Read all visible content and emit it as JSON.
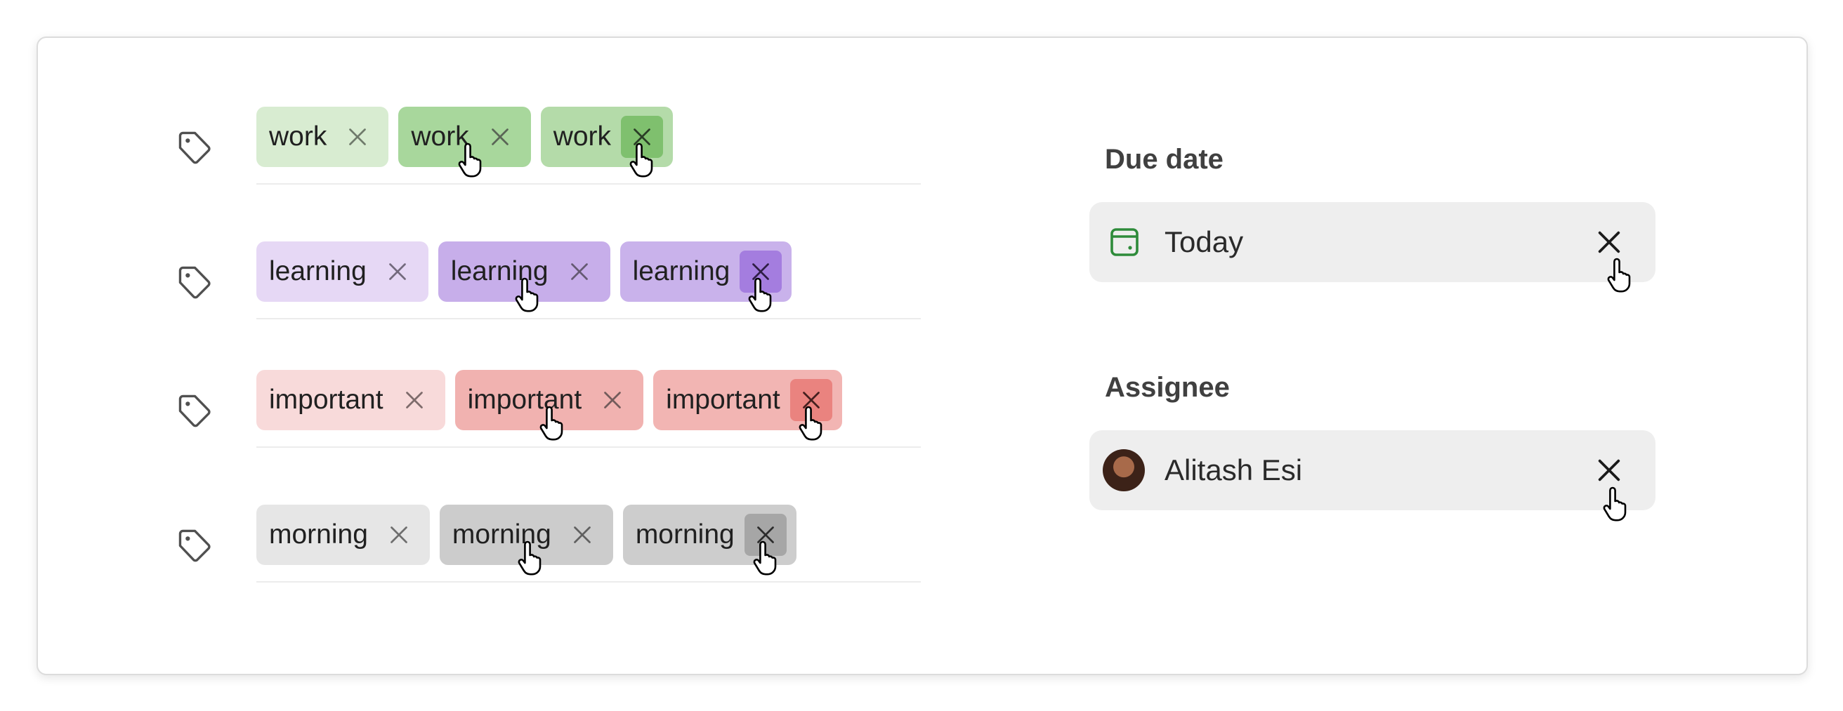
{
  "tags": [
    {
      "icon": "tag-icon",
      "chips": [
        {
          "label": "work",
          "state": "default",
          "bg": "#d8ecd1",
          "xbg": "transparent",
          "xcolor": "#6f7a6b"
        },
        {
          "label": "work",
          "state": "hover",
          "bg": "#a8d79c",
          "xbg": "transparent",
          "xcolor": "#5a6656"
        },
        {
          "label": "work",
          "state": "hover-x",
          "bg": "#b4dba9",
          "xbg": "#7fc06e",
          "xcolor": "#2a3d26"
        }
      ]
    },
    {
      "icon": "tag-icon",
      "chips": [
        {
          "label": "learning",
          "state": "default",
          "bg": "#e6d8f5",
          "xbg": "transparent",
          "xcolor": "#736a7d"
        },
        {
          "label": "learning",
          "state": "hover",
          "bg": "#c7aeea",
          "xbg": "transparent",
          "xcolor": "#655a73"
        },
        {
          "label": "learning",
          "state": "hover-x",
          "bg": "#c9b2eb",
          "xbg": "#a47ddf",
          "xcolor": "#2e1e45"
        }
      ]
    },
    {
      "icon": "tag-icon",
      "chips": [
        {
          "label": "important",
          "state": "default",
          "bg": "#f8dada",
          "xbg": "transparent",
          "xcolor": "#7e6b6b"
        },
        {
          "label": "important",
          "state": "hover",
          "bg": "#f1b2b0",
          "xbg": "transparent",
          "xcolor": "#735b5b"
        },
        {
          "label": "important",
          "state": "hover-x",
          "bg": "#f2b5b3",
          "xbg": "#ea837f",
          "xcolor": "#45201f"
        }
      ]
    },
    {
      "icon": "tag-icon",
      "chips": [
        {
          "label": "morning",
          "state": "default",
          "bg": "#e6e6e6",
          "xbg": "transparent",
          "xcolor": "#6e6e6e"
        },
        {
          "label": "morning",
          "state": "hover",
          "bg": "#cccccc",
          "xbg": "transparent",
          "xcolor": "#606060"
        },
        {
          "label": "morning",
          "state": "hover-x",
          "bg": "#cdcdcd",
          "xbg": "#a6a6a6",
          "xcolor": "#2c2c2c"
        }
      ]
    }
  ],
  "due_date": {
    "title": "Due date",
    "value": "Today",
    "icon": "calendar-icon",
    "icon_color": "#2e8b3a",
    "clear_icon": "close-icon"
  },
  "assignee": {
    "title": "Assignee",
    "value": "Alitash Esi",
    "avatar": "avatar",
    "clear_icon": "close-icon"
  }
}
